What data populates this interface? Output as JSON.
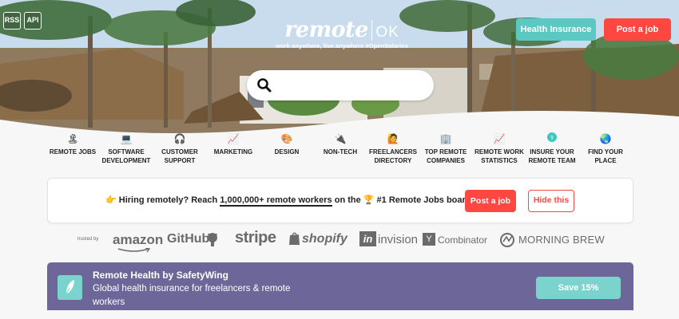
{
  "header": {
    "rss_label": "RSS",
    "api_label": "API",
    "logo_remote": "remote",
    "logo_ok": "OK",
    "tagline": "work anywhere, live anywhere #OpenSalaries",
    "health_insurance_label": "Health Insurance",
    "post_job_label": "Post a job",
    "search_placeholder": ""
  },
  "categories": [
    {
      "icon": "🏝",
      "label": "REMOTE JOBS"
    },
    {
      "icon": "💻",
      "label": "SOFTWARE DEVELOPMENT"
    },
    {
      "icon": "🎧",
      "label": "CUSTOMER SUPPORT"
    },
    {
      "icon": "📈",
      "label": "MARKETING"
    },
    {
      "icon": "🎨",
      "label": "DESIGN"
    },
    {
      "icon": "🔌",
      "label": "NON-TECH"
    },
    {
      "icon": "🙋",
      "label": "FREELANCERS DIRECTORY"
    },
    {
      "icon": "🏢",
      "label": "TOP REMOTE COMPANIES"
    },
    {
      "icon": "📈",
      "label": "REMOTE WORK STATISTICS"
    },
    {
      "icon": "⚕",
      "label": "INSURE YOUR REMOTE TEAM"
    },
    {
      "icon": "🌏",
      "label": "FIND YOUR PLACE"
    }
  ],
  "hiring_banner": {
    "emoji_hand": "👉",
    "text_prefix": "Hiring remotely? Reach",
    "text_highlight": "1,000,000+ remote workers",
    "text_mid": "on the",
    "emoji_trophy": "🏆",
    "text_suffix": "#1 Remote Jobs board",
    "post_job_label": "Post a job",
    "hide_label": "Hide this"
  },
  "trusted": {
    "label": "trusted by",
    "logos": [
      "amazon",
      "GitHub",
      "stripe",
      "shopify",
      "invision",
      "Combinator",
      "MORNING BREW"
    ],
    "yc_letter": "Y",
    "in_letters": "in"
  },
  "safetywing": {
    "title": "Remote Health by SafetyWing",
    "description": "Global health insurance for freelancers & remote workers",
    "save_label": "Save 15%"
  },
  "colors": {
    "accent_red": "#ff4742",
    "teal": "#5bc8c2",
    "safetywing_purple": "#6c6699"
  }
}
